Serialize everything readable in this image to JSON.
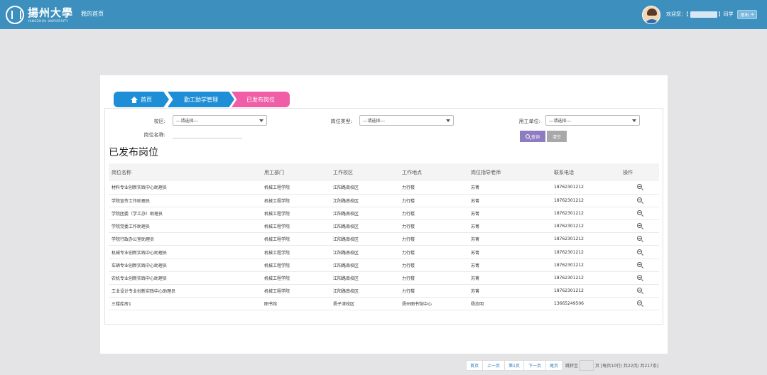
{
  "header": {
    "logo_cn": "揚州大學",
    "logo_en": "YANGZHOU UNIVERSITY",
    "nav_home": "我的首页",
    "welcome_prefix": "欢迎您：【",
    "welcome_suffix": "】同学",
    "logout_label": "退出"
  },
  "breadcrumb": [
    "首页",
    "勤工助学管理",
    "已发布岗位"
  ],
  "filters": {
    "campus_label": "校区:",
    "campus_value": "---请选择---",
    "type_label": "岗位类型:",
    "type_value": "---请选择---",
    "unit_label": "用工单位:",
    "unit_value": "---请选择---",
    "name_label": "岗位名称:",
    "search_label": "查询",
    "clear_label": "清空"
  },
  "title": "已发布岗位",
  "table": {
    "headers": [
      "岗位名称",
      "用工部门",
      "工作校区",
      "工作地点",
      "岗位指导老师",
      "联系电话",
      "操作"
    ],
    "rows": [
      [
        "材料专业创新实践中心助理员",
        "机械工程学院",
        "江阳路南校区",
        "力行楼",
        "苏菁",
        "18762301212"
      ],
      [
        "学院宣传工作助理员",
        "机械工程学院",
        "江阳路南校区",
        "力行楼",
        "苏菁",
        "18762301212"
      ],
      [
        "学院团委（学工办）助理员",
        "机械工程学院",
        "江阳路南校区",
        "力行楼",
        "苏菁",
        "18762301212"
      ],
      [
        "学院党委工作助理员",
        "机械工程学院",
        "江阳路南校区",
        "力行楼",
        "苏菁",
        "18762301212"
      ],
      [
        "学院行政办公室助理员",
        "机械工程学院",
        "江阳路南校区",
        "力行楼",
        "苏菁",
        "18762301212"
      ],
      [
        "机械专业创新实践中心助理员",
        "机械工程学院",
        "江阳路南校区",
        "力行楼",
        "苏菁",
        "18762301212"
      ],
      [
        "车辆专业创新实践中心助理员",
        "机械工程学院",
        "江阳路南校区",
        "力行楼",
        "苏菁",
        "18762301212"
      ],
      [
        "农机专业创新实践中心助理员",
        "机械工程学院",
        "江阳路南校区",
        "力行楼",
        "苏菁",
        "18762301212"
      ],
      [
        "工业设计专业创新实践中心助理员",
        "机械工程学院",
        "江阳路南校区",
        "力行楼",
        "苏菁",
        "18762301212"
      ],
      [
        "三楼库房1",
        "图书馆",
        "扬子津校区",
        "扬州图书馆中心",
        "杨志明",
        "13665249506"
      ]
    ]
  },
  "pagination": {
    "first": "首页",
    "prev": "上一页",
    "current": "第1页",
    "next": "下一页",
    "last": "尾页",
    "jump_prefix": "跳转至",
    "summary": "页 [每页10行/ 共22页/ 共217条]"
  }
}
